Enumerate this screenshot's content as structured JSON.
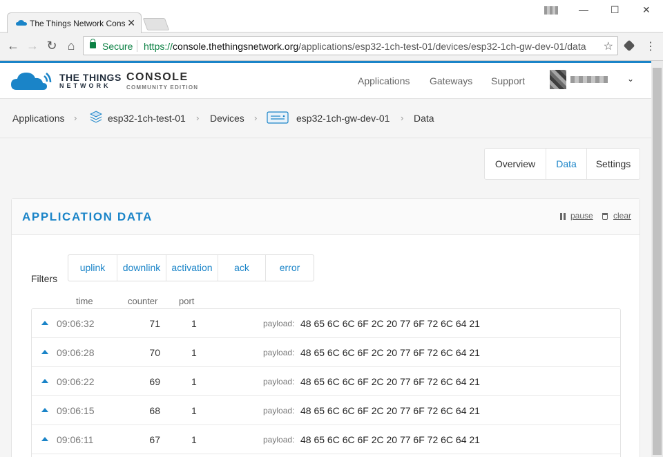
{
  "browser": {
    "tab_title": "The Things Network Cons",
    "tab_close": "✕",
    "secure_label": "Secure",
    "url_scheme": "https://",
    "url_host": "console.thethingsnetwork.org",
    "url_path": "/applications/esp32-1ch-test-01/devices/esp32-1ch-gw-dev-01/data",
    "star": "☆",
    "back": "←",
    "forward": "→",
    "reload": "↻",
    "home": "⌂",
    "kebab": "⋮",
    "minimize": "—",
    "maximize": "☐",
    "close": "✕"
  },
  "header": {
    "brand_top": "THE THINGS",
    "brand_bottom": "NETWORK",
    "console_title": "CONSOLE",
    "console_sub": "COMMUNITY EDITION",
    "nav": [
      "Applications",
      "Gateways",
      "Support"
    ],
    "user_caret": "⌄"
  },
  "breadcrumb": {
    "items": [
      "Applications",
      "esp32-1ch-test-01",
      "Devices",
      "esp32-1ch-gw-dev-01",
      "Data"
    ],
    "separator": "›"
  },
  "page_tabs": {
    "items": [
      "Overview",
      "Data",
      "Settings"
    ],
    "active": "Data"
  },
  "panel": {
    "title": "APPLICATION DATA",
    "pause_label": "pause",
    "clear_label": "clear",
    "filters_label": "Filters",
    "filters": [
      "uplink",
      "downlink",
      "activation",
      "ack",
      "error"
    ],
    "columns": [
      "time",
      "counter",
      "port"
    ],
    "payload_label": "payload:",
    "rows": [
      {
        "time": "09:06:32",
        "counter": "71",
        "port": "1",
        "payload": "48 65 6C 6C 6F 2C 20 77 6F 72 6C 64 21"
      },
      {
        "time": "09:06:28",
        "counter": "70",
        "port": "1",
        "payload": "48 65 6C 6C 6F 2C 20 77 6F 72 6C 64 21"
      },
      {
        "time": "09:06:22",
        "counter": "69",
        "port": "1",
        "payload": "48 65 6C 6C 6F 2C 20 77 6F 72 6C 64 21"
      },
      {
        "time": "09:06:15",
        "counter": "68",
        "port": "1",
        "payload": "48 65 6C 6C 6F 2C 20 77 6F 72 6C 64 21"
      },
      {
        "time": "09:06:11",
        "counter": "67",
        "port": "1",
        "payload": "48 65 6C 6C 6F 2C 20 77 6F 72 6C 64 21"
      }
    ]
  },
  "colors": {
    "accent": "#1a84c8",
    "secure_green": "#0b8043"
  }
}
